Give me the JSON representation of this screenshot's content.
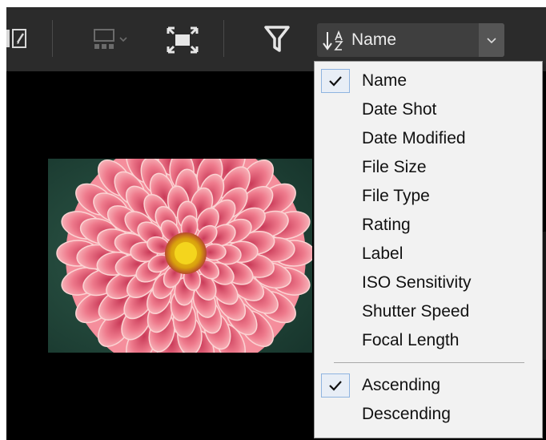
{
  "toolbar": {
    "icons": [
      "compare-view-icon",
      "layout-grid-icon",
      "fullscreen-icon",
      "filter-icon"
    ]
  },
  "sort": {
    "current_label": "Name",
    "glyph": "sort-ascending-az-icon"
  },
  "menu": {
    "fields": [
      {
        "label": "Name",
        "checked": true
      },
      {
        "label": "Date Shot",
        "checked": false
      },
      {
        "label": "Date Modified",
        "checked": false
      },
      {
        "label": "File Size",
        "checked": false
      },
      {
        "label": "File Type",
        "checked": false
      },
      {
        "label": "Rating",
        "checked": false
      },
      {
        "label": "Label",
        "checked": false
      },
      {
        "label": "ISO Sensitivity",
        "checked": false
      },
      {
        "label": "Shutter Speed",
        "checked": false
      },
      {
        "label": "Focal Length",
        "checked": false
      }
    ],
    "orders": [
      {
        "label": "Ascending",
        "checked": true
      },
      {
        "label": "Descending",
        "checked": false
      }
    ]
  },
  "colors": {
    "toolbar_bg": "#2b2b2b",
    "menu_bg": "#f2f2f2",
    "check_highlight": "#8fb4e0",
    "photo_subject": "#ee7a8c"
  }
}
